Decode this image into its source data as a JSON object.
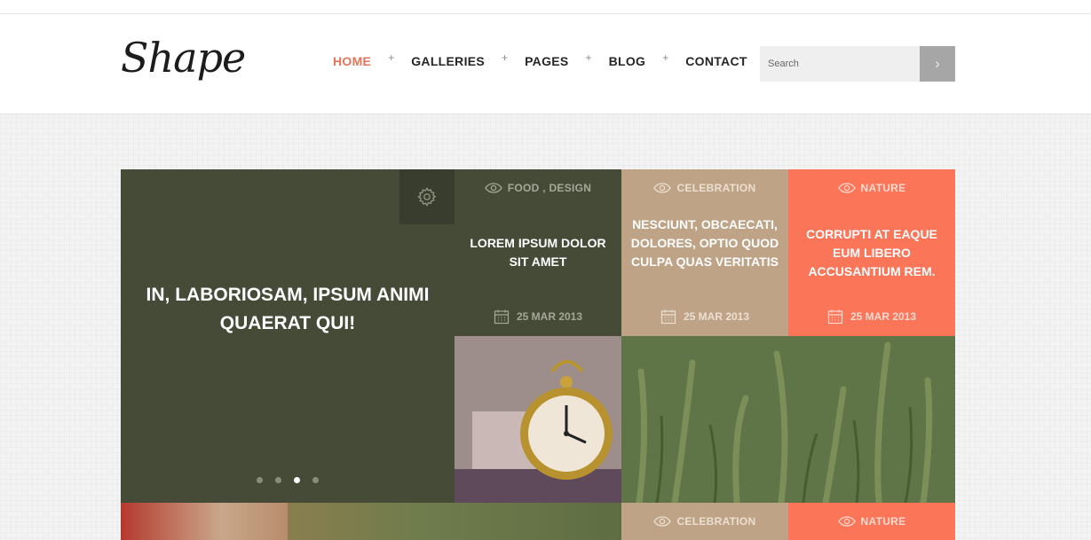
{
  "header": {
    "logo": "Shape",
    "nav": [
      {
        "label": "HOME",
        "active": true
      },
      {
        "label": "GALLERIES",
        "active": false
      },
      {
        "label": "PAGES",
        "active": false
      },
      {
        "label": "BLOG",
        "active": false
      },
      {
        "label": "CONTACT",
        "active": false
      }
    ],
    "nav_separator": "+",
    "search": {
      "placeholder": "Search",
      "button_icon": "chevron-right-icon"
    }
  },
  "hero": {
    "title": "IN, LABORIOSAM, IPSUM ANIMI QUAERAT QUI!",
    "settings_icon": "gear-icon",
    "slider": {
      "count": 4,
      "active_index": 2
    }
  },
  "cards": [
    {
      "category": "FOOD , DESIGN",
      "title": "LOREM IPSUM DOLOR SIT AMET",
      "date": "25 MAR 2013",
      "color": "#464b38"
    },
    {
      "category": "CELEBRATION",
      "title": "NESCIUNT, OBCAECATI, DOLORES, OPTIO QUOD CULPA QUAS VERITATIS",
      "date": "25 MAR 2013",
      "color": "#bfa386"
    },
    {
      "category": "NATURE",
      "title": "CORRUPTI AT EAQUE EUM LIBERO ACCUSANTIUM REM.",
      "date": "25 MAR 2013",
      "color": "#fb7559"
    }
  ],
  "bottom_cards": [
    {
      "category": "CELEBRATION"
    },
    {
      "category": "NATURE"
    }
  ],
  "colors": {
    "accent": "#e9735a",
    "olive": "#464b38",
    "tan": "#bfa386",
    "coral": "#fb7559"
  }
}
